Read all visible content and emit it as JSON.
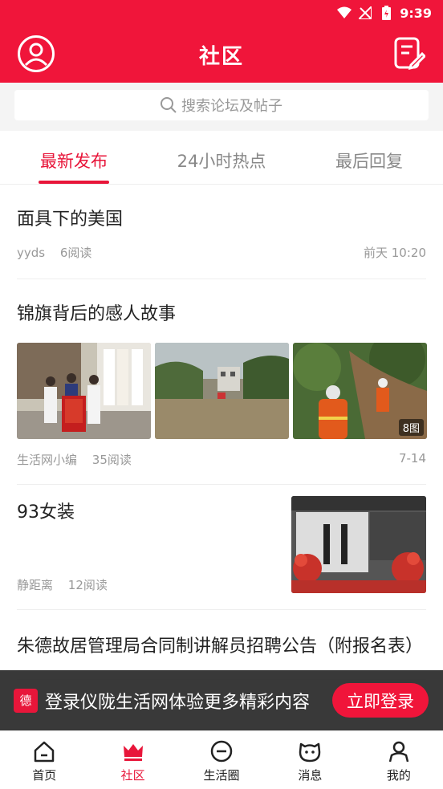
{
  "status_bar": {
    "time": "9:39"
  },
  "header": {
    "title": "社区"
  },
  "search": {
    "placeholder": "搜索论坛及帖子"
  },
  "tabs": [
    {
      "label": "最新发布",
      "active": true
    },
    {
      "label": "24小时热点",
      "active": false
    },
    {
      "label": "最后回复",
      "active": false
    }
  ],
  "posts": [
    {
      "title": "面具下的美国",
      "author": "yyds",
      "reads": "6阅读",
      "time": "前天 10:20"
    },
    {
      "title": "锦旗背后的感人故事",
      "author": "生活网小编",
      "reads": "35阅读",
      "time": "7-14",
      "image_count": "8图"
    },
    {
      "title": "93女装",
      "author": "静距离",
      "reads": "12阅读"
    },
    {
      "title": "朱德故居管理局合同制讲解员招聘公告（附报名表）",
      "author": "",
      "reads": ""
    }
  ],
  "login_banner": {
    "logo": "德",
    "text": "登录仪陇生活网体验更多精彩内容",
    "button": "立即登录"
  },
  "bottom_nav": [
    {
      "label": "首页",
      "icon": "home-icon"
    },
    {
      "label": "社区",
      "icon": "crown-icon",
      "active": true
    },
    {
      "label": "生活圈",
      "icon": "minus-circle-icon"
    },
    {
      "label": "消息",
      "icon": "cat-face-icon"
    },
    {
      "label": "我的",
      "icon": "person-icon"
    }
  ],
  "colors": {
    "brand": "#f0153a",
    "accent": "#e8163a"
  }
}
